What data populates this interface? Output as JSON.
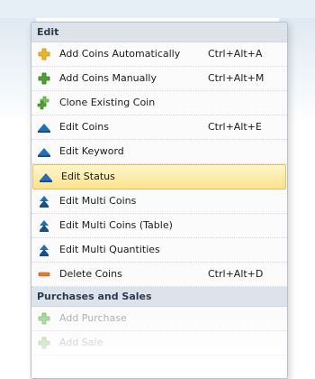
{
  "menu": {
    "sections": [
      {
        "title": "Edit",
        "items": [
          {
            "label": "Add Coins Automatically",
            "shortcut": "Ctrl+Alt+A",
            "icon": "plus-yellow-icon"
          },
          {
            "label": "Add Coins Manually",
            "shortcut": "Ctrl+Alt+M",
            "icon": "plus-green-icon"
          },
          {
            "label": "Clone Existing Coin",
            "shortcut": "",
            "icon": "clone-plus-icon"
          },
          {
            "label": "Edit Coins",
            "shortcut": "Ctrl+Alt+E",
            "icon": "edit-triangle-icon"
          },
          {
            "label": "Edit Keyword",
            "shortcut": "",
            "icon": "edit-triangle-icon"
          },
          {
            "label": "Edit Status",
            "shortcut": "",
            "icon": "edit-triangle-icon",
            "selected": true
          },
          {
            "label": "Edit Multi Coins",
            "shortcut": "",
            "icon": "multi-edit-icon"
          },
          {
            "label": "Edit Multi Coins (Table)",
            "shortcut": "",
            "icon": "multi-edit-icon"
          },
          {
            "label": "Edit Multi Quantities",
            "shortcut": "",
            "icon": "multi-edit-icon"
          },
          {
            "label": "Delete Coins",
            "shortcut": "Ctrl+Alt+D",
            "icon": "minus-orange-icon"
          }
        ]
      },
      {
        "title": "Purchases and Sales",
        "items": [
          {
            "label": "Add Purchase",
            "shortcut": "",
            "icon": "plus-green-icon",
            "disabled": true
          },
          {
            "label": "Add Sale",
            "shortcut": "",
            "icon": "plus-green-icon",
            "disabled": true
          }
        ]
      }
    ]
  },
  "colors": {
    "selection_fill": "#fbe38e",
    "selection_border": "#e3c25e",
    "header_bg": "#dde3ea",
    "icon_blue": "#1f6fbf",
    "icon_green": "#4aa52e",
    "icon_yellow": "#f2b51c",
    "icon_orange": "#e8782a"
  }
}
